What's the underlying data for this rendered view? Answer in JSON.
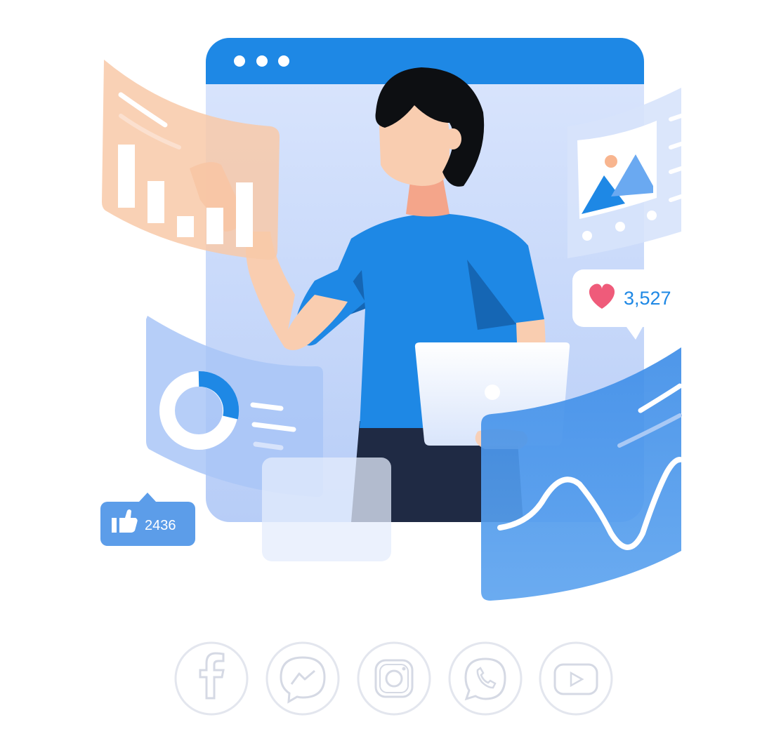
{
  "browser_window": {
    "dots": 3
  },
  "heart_badge": {
    "count": "3,527",
    "icon": "heart-icon"
  },
  "like_badge": {
    "count": "2436",
    "icon": "thumbs-up-icon"
  },
  "social_icons": [
    {
      "name": "facebook-icon"
    },
    {
      "name": "messenger-icon"
    },
    {
      "name": "instagram-icon"
    },
    {
      "name": "whatsapp-icon"
    },
    {
      "name": "youtube-icon"
    }
  ],
  "colors": {
    "primary_blue": "#1e88e5",
    "light_blue_panel": "#d3e2fb",
    "peach_panel": "#f8c9a8",
    "heart": "#ef5b7a",
    "dark_hair": "#0d0f12",
    "pants": "#1f2a44",
    "skin": "#f9cdb0"
  }
}
